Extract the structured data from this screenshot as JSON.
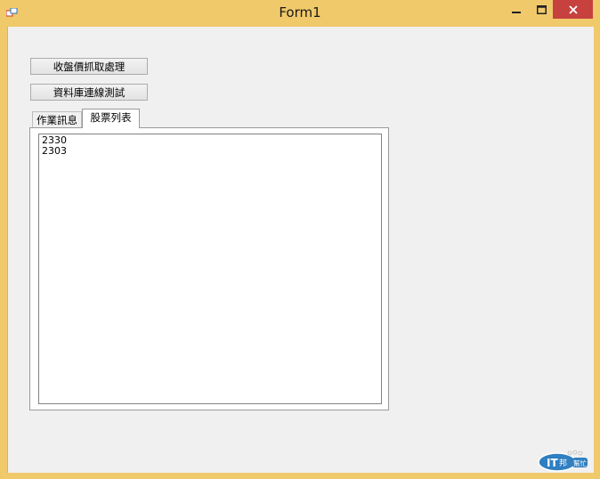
{
  "window": {
    "title": "Form1"
  },
  "titlebar": {
    "minimize_glyph": "‒",
    "maximize_glyph": "☐",
    "close_glyph": "✕"
  },
  "buttons": {
    "closing_price": "收盤價抓取處理",
    "db_test": "資料庫連線測試"
  },
  "tabs": [
    {
      "label": "作業訊息",
      "selected": false
    },
    {
      "label": "股票列表",
      "selected": true
    }
  ],
  "stock_list": [
    "2330",
    "2303"
  ],
  "watermark": {
    "text": "IT邦",
    "sub": "幫忙"
  },
  "colors": {
    "frame": "#f0c96a",
    "close": "#c7413e",
    "client": "#f0f0f0"
  }
}
